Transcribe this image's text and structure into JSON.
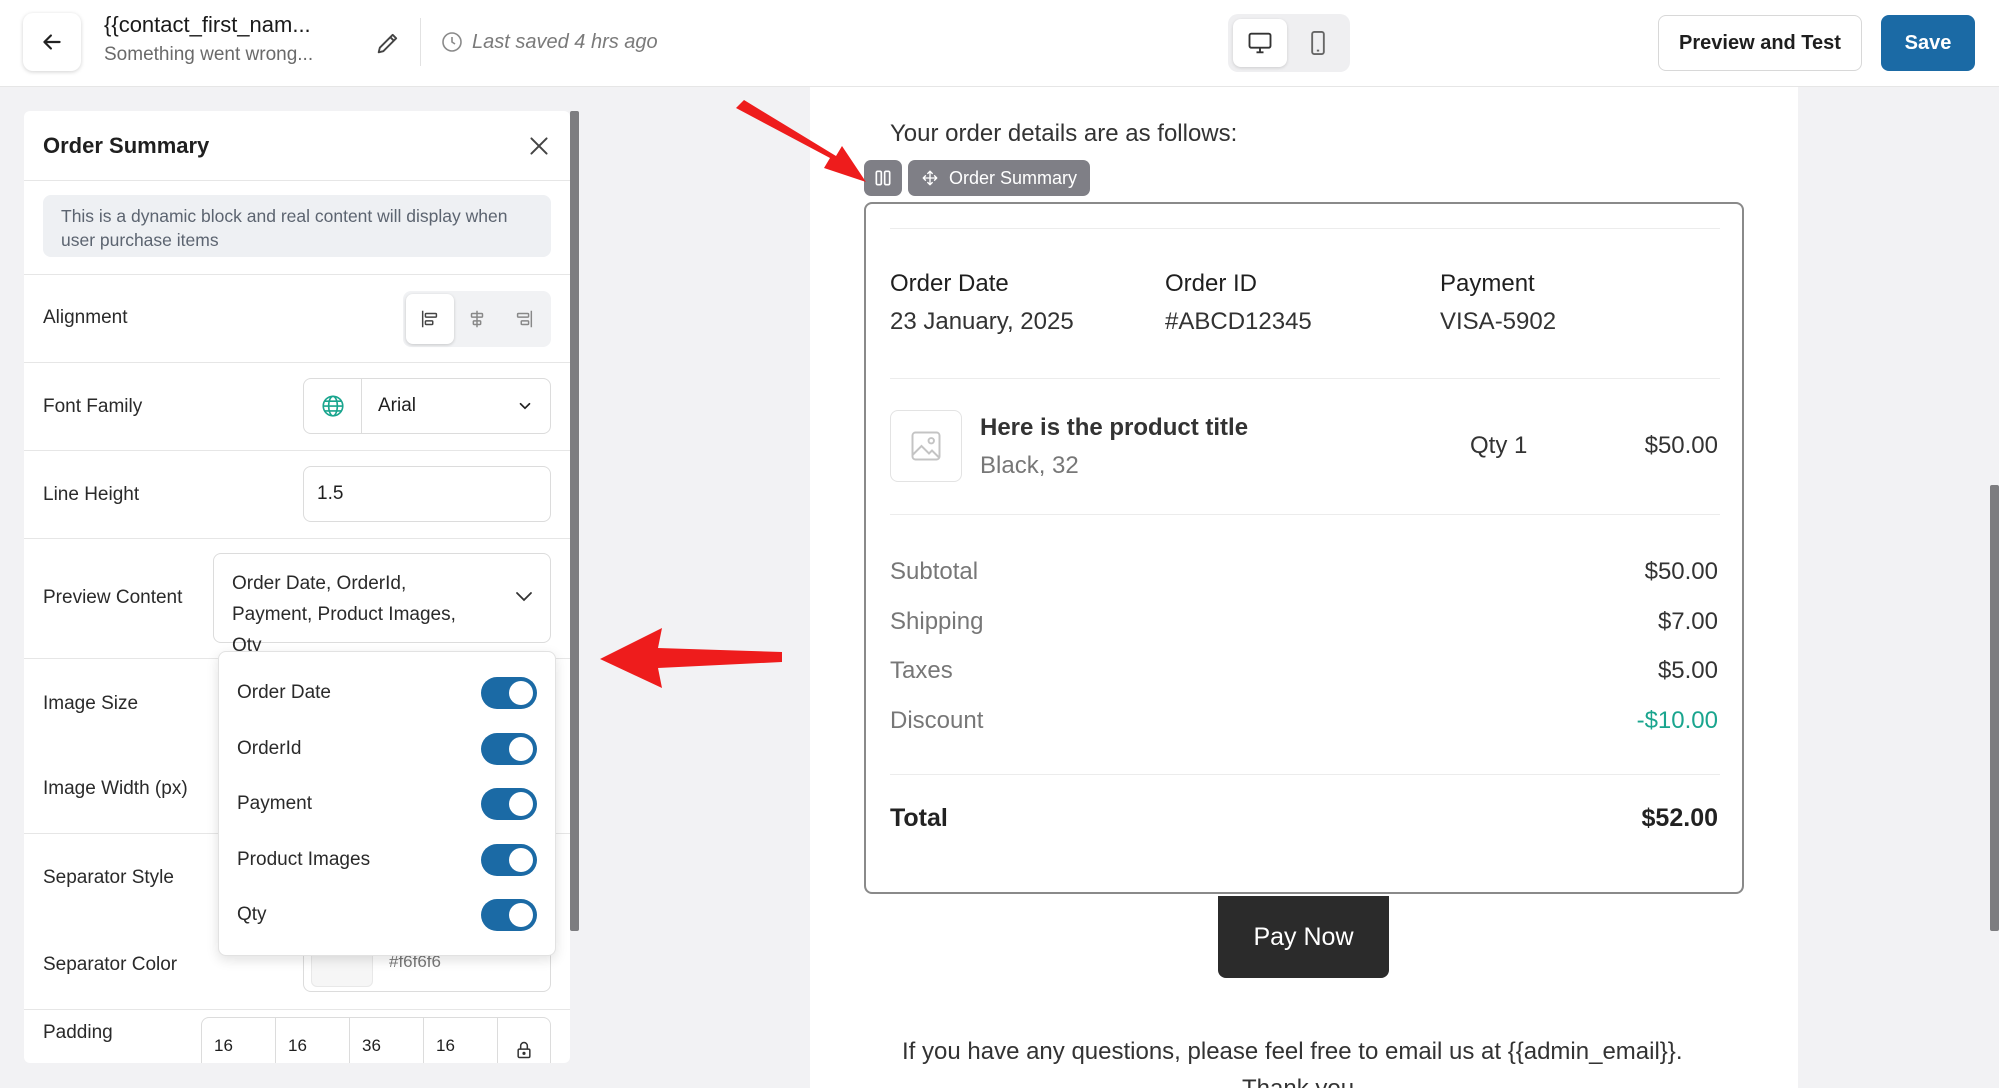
{
  "header": {
    "title": "{{contact_first_nam...",
    "subtitle": "Something went wrong...",
    "last_saved": "Last saved 4 hrs ago",
    "preview_label": "Preview and Test",
    "save_label": "Save"
  },
  "panel": {
    "title": "Order Summary",
    "info": "This is a dynamic block and real content will display when user purchase items",
    "alignment_label": "Alignment",
    "font_family_label": "Font Family",
    "font_family_value": "Arial",
    "line_height_label": "Line Height",
    "line_height_value": "1.5",
    "preview_content_label": "Preview Content",
    "preview_content_value": "Order Date, OrderId, Payment, Product Images, Qty",
    "image_size_label": "Image Size",
    "image_width_label": "Image Width (px)",
    "separator_style_label": "Separator Style",
    "separator_color_label": "Separator Color",
    "separator_color_value": "#f6f6f6",
    "padding_label": "Padding",
    "padding_values": [
      "16",
      "16",
      "36",
      "16"
    ]
  },
  "dropdown": {
    "items": [
      {
        "label": "Order Date",
        "enabled": true
      },
      {
        "label": "OrderId",
        "enabled": true
      },
      {
        "label": "Payment",
        "enabled": true
      },
      {
        "label": "Product Images",
        "enabled": true
      },
      {
        "label": "Qty",
        "enabled": true
      }
    ]
  },
  "email": {
    "greeting": "Your order details are as follows:",
    "block_tag": "Order Summary",
    "order_date_label": "Order Date",
    "order_date_value": "23 January, 2025",
    "order_id_label": "Order ID",
    "order_id_value": "#ABCD12345",
    "payment_label": "Payment",
    "payment_value": "VISA-5902",
    "product_title": "Here is the product title",
    "product_variant": "Black, 32",
    "product_qty": "Qty 1",
    "product_price": "$50.00",
    "summary": [
      {
        "label": "Subtotal",
        "value": "$50.00"
      },
      {
        "label": "Shipping",
        "value": "$7.00"
      },
      {
        "label": "Taxes",
        "value": "$5.00"
      },
      {
        "label": "Discount",
        "value": "-$10.00"
      }
    ],
    "total_label": "Total",
    "total_value": "$52.00",
    "pay_button": "Pay Now",
    "footer": "If you have any questions, please feel free to email us at {{admin_email}}.",
    "footer_cut": "Thank you"
  },
  "colors": {
    "accent": "#1b6aa5",
    "discount": "#1aa58e",
    "annotation_arrow": "#ee1c1c"
  }
}
